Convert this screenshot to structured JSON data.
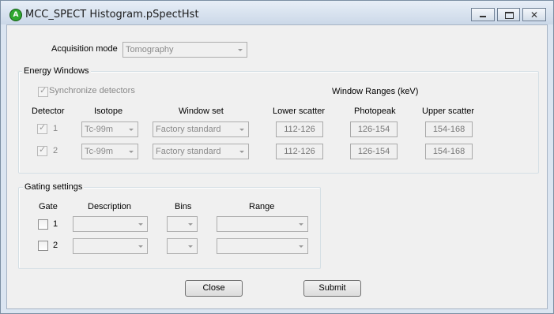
{
  "window": {
    "title": "MCC_SPECT Histogram.pSpectHst",
    "icon_letter": "A"
  },
  "acquisition": {
    "label": "Acquisition mode",
    "value": "Tomography"
  },
  "energy": {
    "legend": "Energy Windows",
    "sync_label": "Synchronize detectors",
    "sync_checked": true,
    "window_ranges_label": "Window Ranges (keV)",
    "headers": {
      "detector": "Detector",
      "isotope": "Isotope",
      "window_set": "Window set",
      "lower": "Lower scatter",
      "photopeak": "Photopeak",
      "upper": "Upper scatter"
    },
    "rows": [
      {
        "num": "1",
        "checked": true,
        "isotope": "Tc-99m",
        "window_set": "Factory standard",
        "lower": "112-126",
        "photopeak": "126-154",
        "upper": "154-168"
      },
      {
        "num": "2",
        "checked": true,
        "isotope": "Tc-99m",
        "window_set": "Factory standard",
        "lower": "112-126",
        "photopeak": "126-154",
        "upper": "154-168"
      }
    ]
  },
  "gating": {
    "legend": "Gating settings",
    "headers": {
      "gate": "Gate",
      "description": "Description",
      "bins": "Bins",
      "range": "Range"
    },
    "rows": [
      {
        "num": "1",
        "checked": false,
        "description": "",
        "bins": "",
        "range": ""
      },
      {
        "num": "2",
        "checked": false,
        "description": "",
        "bins": "",
        "range": ""
      }
    ]
  },
  "buttons": {
    "close": "Close",
    "submit": "Submit"
  }
}
